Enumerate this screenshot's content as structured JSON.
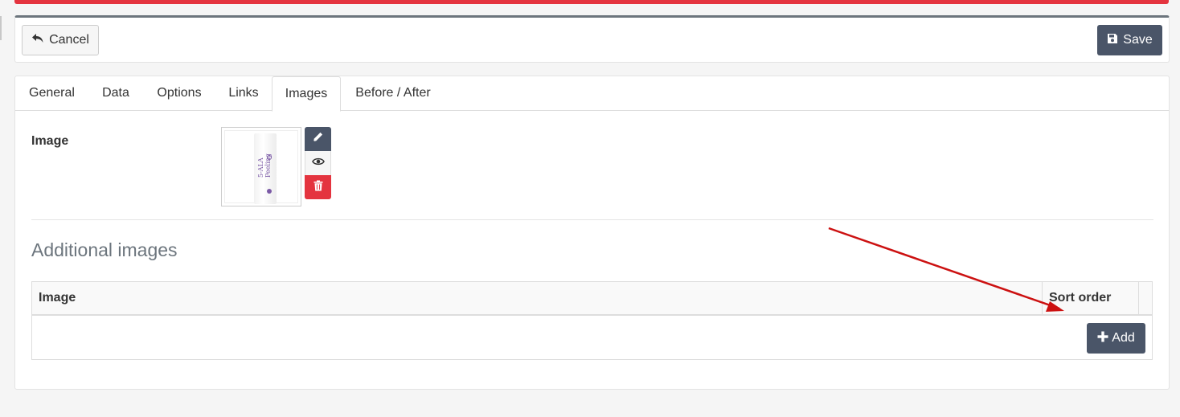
{
  "toolbar": {
    "cancel_label": "Cancel",
    "save_label": "Save"
  },
  "tabs": [
    {
      "label": "General",
      "active": false
    },
    {
      "label": "Data",
      "active": false
    },
    {
      "label": "Options",
      "active": false
    },
    {
      "label": "Links",
      "active": false
    },
    {
      "label": "Images",
      "active": true
    },
    {
      "label": "Before / After",
      "active": false
    }
  ],
  "image_section": {
    "label": "Image",
    "thumbnail_text": "5-ALA Peeling"
  },
  "additional_images": {
    "title": "Additional images",
    "columns": [
      "Image",
      "Sort order"
    ],
    "rows": [],
    "add_label": "Add"
  },
  "colors": {
    "accent_red": "#e4343f",
    "button_dark": "#4a5568",
    "annotation_arrow": "#cc1111"
  }
}
